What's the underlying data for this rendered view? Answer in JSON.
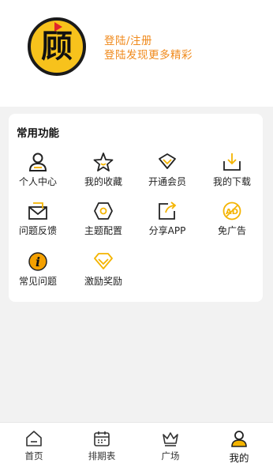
{
  "header": {
    "avatar_glyph": "顾",
    "login_title": "登陆/注册",
    "login_subtitle": "登陆发现更多精彩",
    "accent_color": "#f08a1c"
  },
  "common_functions": {
    "title": "常用功能",
    "items": [
      {
        "label": "个人中心",
        "icon": "person-icon"
      },
      {
        "label": "我的收藏",
        "icon": "star-icon"
      },
      {
        "label": "开通会员",
        "icon": "vip-icon"
      },
      {
        "label": "我的下载",
        "icon": "download-icon"
      },
      {
        "label": "问题反馈",
        "icon": "mail-icon"
      },
      {
        "label": "主题配置",
        "icon": "theme-icon"
      },
      {
        "label": "分享APP",
        "icon": "share-icon"
      },
      {
        "label": "免广告",
        "icon": "no-ad-icon"
      },
      {
        "label": "常见问题",
        "icon": "info-icon"
      },
      {
        "label": "激励奖励",
        "icon": "diamond-icon"
      }
    ]
  },
  "tabbar": {
    "items": [
      {
        "label": "首页",
        "icon": "home-icon"
      },
      {
        "label": "排期表",
        "icon": "calendar-icon"
      },
      {
        "label": "广场",
        "icon": "crown-icon"
      },
      {
        "label": "我的",
        "icon": "profile-icon"
      }
    ],
    "active_index": 3
  }
}
